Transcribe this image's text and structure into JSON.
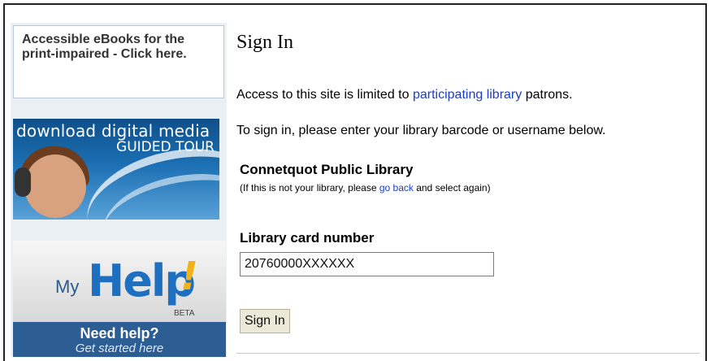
{
  "sidebar": {
    "accessible_link": "Accessible eBooks for the print-impaired - Click here.",
    "tour_banner": {
      "line1": "download digital media",
      "line2": "GUIDED TOUR"
    },
    "help_banner": {
      "my": "My",
      "help": "Help",
      "bang": "!",
      "beta": "BETA",
      "need_help": "Need help?",
      "get_started": "Get started here"
    }
  },
  "main": {
    "title": "Sign In",
    "access_text_before": "Access to this site is limited to ",
    "access_link": "participating library",
    "access_text_after": " patrons.",
    "instructions": "To sign in, please enter your library barcode or username below.",
    "library_name": "Connetquot Public Library",
    "library_note_before": "(If this is not your library, please ",
    "library_note_link": "go back",
    "library_note_after": " and select again)",
    "card_label": "Library card number",
    "card_value": "20760000XXXXXX",
    "signin_button": "Sign In"
  },
  "colors": {
    "link": "#1c3cc4",
    "help_blue": "#1e6fbf",
    "help_accent": "#f2b21a"
  }
}
